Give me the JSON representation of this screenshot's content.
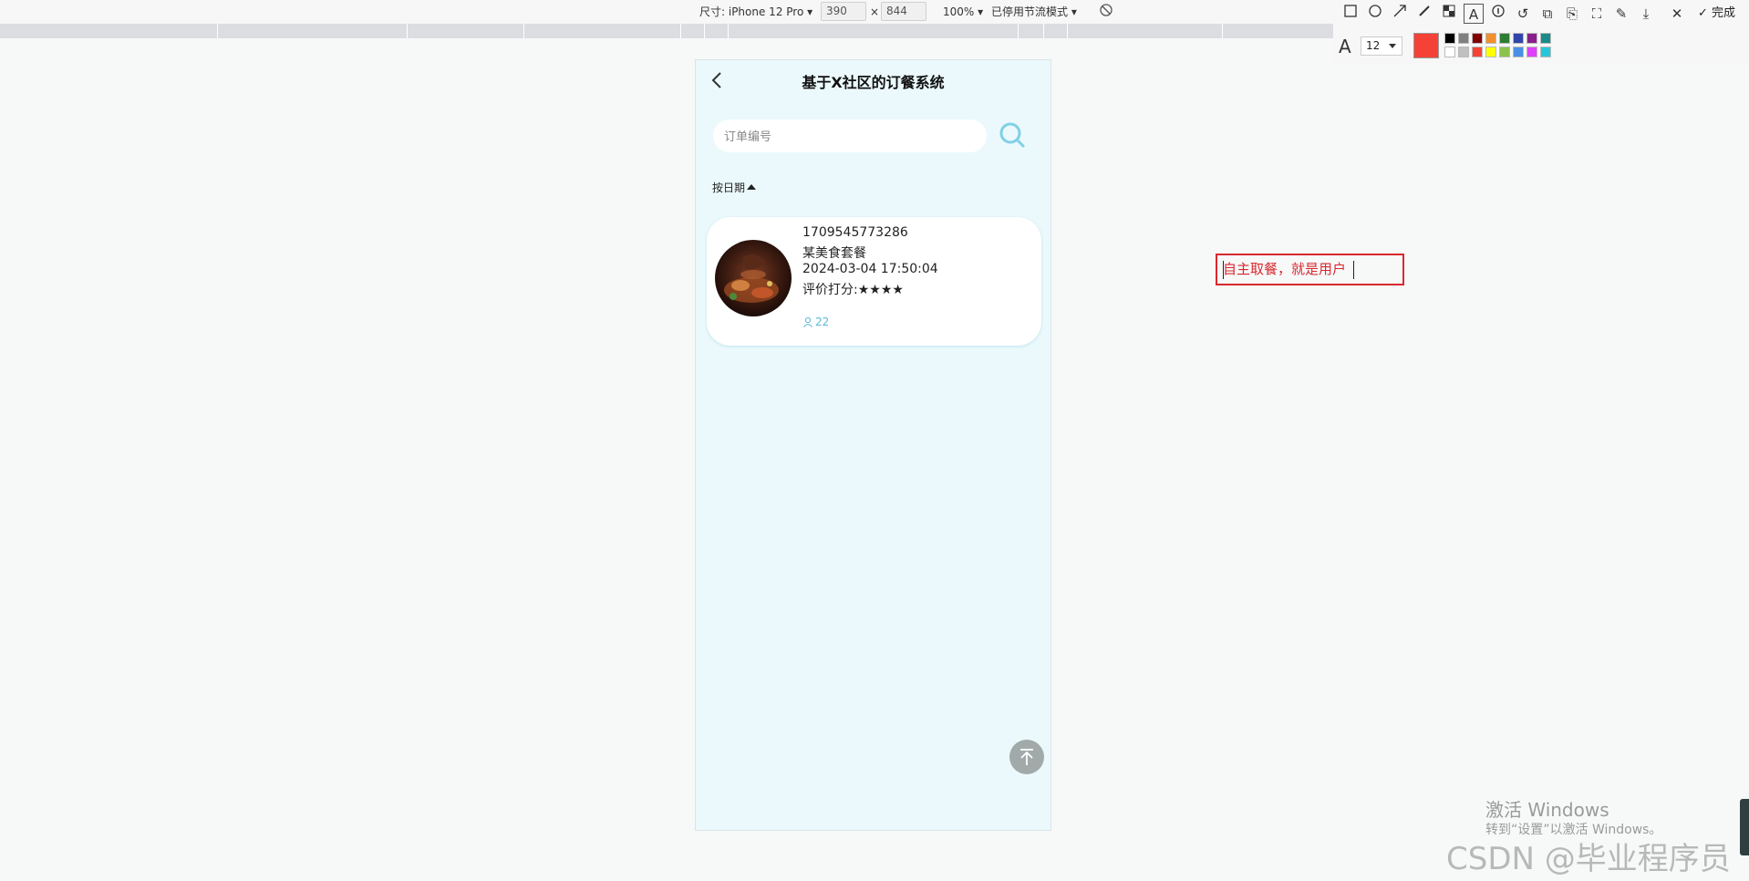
{
  "devtools": {
    "size_label": "尺寸: iPhone 12 Pro",
    "width": "390",
    "times": "×",
    "height": "844",
    "zoom": "100%",
    "throttle": "已停用节流模式"
  },
  "annotation_toolbar": {
    "tools": [
      "rectangle-icon",
      "ellipse-icon",
      "arrow-icon",
      "pencil-icon",
      "mosaic-icon",
      "text-icon",
      "number-icon",
      "undo-icon",
      "crop-icon",
      "copy-icon",
      "screen-icon",
      "pin-icon",
      "download-icon",
      "close-icon"
    ],
    "done_label": "完成",
    "font_size": "12",
    "current_color": "#f44336",
    "palette": [
      "#000000",
      "#808080",
      "#800000",
      "#f0902f",
      "#2e7d32",
      "#3344aa",
      "#8a1f8a",
      "#1a8a8a",
      "#ffffff",
      "#c0c0c0",
      "#f44336",
      "#ffff00",
      "#8bc34a",
      "#4a8fe6",
      "#e040fb",
      "#26c6da"
    ]
  },
  "phone": {
    "title": "基于X社区的订餐系统",
    "search_placeholder": "订单编号",
    "sort_label": "按日期",
    "order": {
      "number": "1709545773286",
      "name": "某美食套餐",
      "datetime": "2024-03-04 17:50:04",
      "rating_label": "评价打分:★★★★",
      "views": "22"
    }
  },
  "annotation_text": "自主取餐，就是用户",
  "watermark": {
    "win_title": "激活 Windows",
    "win_sub": "转到“设置”以激活 Windows。",
    "csdn": "CSDN @毕业程序员"
  }
}
